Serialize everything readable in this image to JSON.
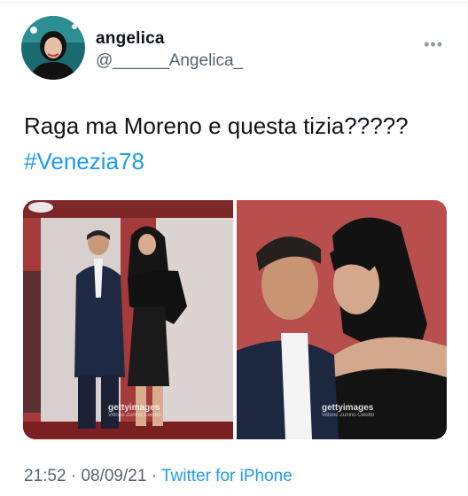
{
  "user": {
    "display_name": "angelica",
    "handle": "@______Angelica_"
  },
  "more_icon": "more-horizontal-icon",
  "tweet": {
    "text": "Raga ma Moreno e questa tizia?????",
    "hashtag": "#Venezia78"
  },
  "media": {
    "watermarks": [
      {
        "brand": "gettyimages",
        "credit": "Vittorio Zunino Celotto"
      },
      {
        "brand": "gettyimages",
        "credit": "Vittorio Zunino Celotto"
      }
    ]
  },
  "meta": {
    "time": "21:52",
    "separator": "·",
    "date": "08/09/21",
    "source": "Twitter for iPhone"
  },
  "colors": {
    "link": "#1d9bf0",
    "secondary_text": "#536471",
    "photo_background": "#a43a3a"
  }
}
